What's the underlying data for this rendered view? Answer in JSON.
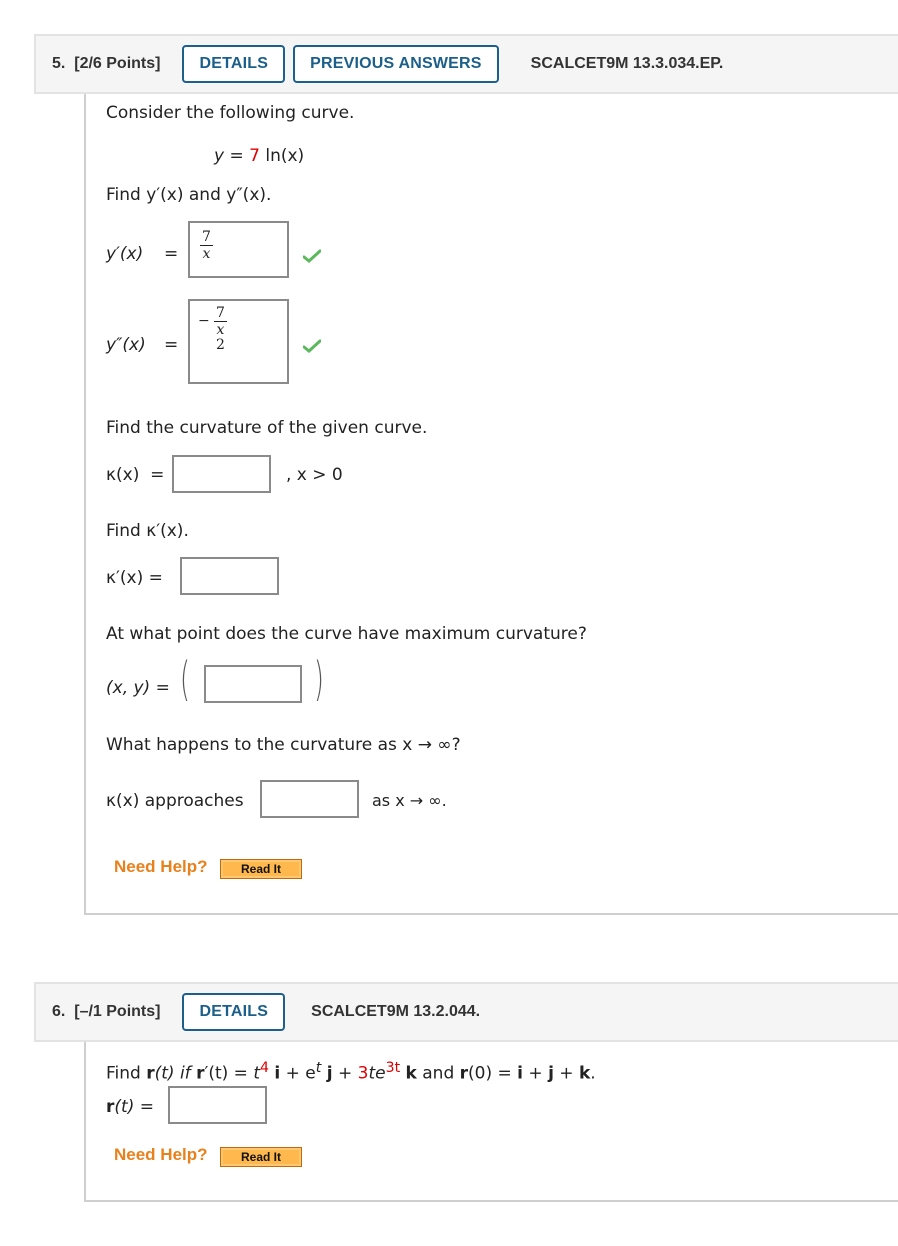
{
  "q5": {
    "number": "5.",
    "points": "[2/6 Points]",
    "details_label": "DETAILS",
    "previous_answers_label": "PREVIOUS ANSWERS",
    "code": "SCALCET9M 13.3.034.EP.",
    "intro": "Consider the following curve.",
    "equation": {
      "lhs": "y",
      "eq": "=",
      "coef": "7",
      "rhs": "ln(x)"
    },
    "find_derivs": "Find y′(x) and y″(x).",
    "yprime_label": "y′(x)",
    "yprime_answer": {
      "num": "7",
      "den": "x",
      "status": "correct"
    },
    "ydouble_label": "y″(x)",
    "ydouble_answer": {
      "sign": "−",
      "num": "7",
      "den": "x",
      "extra": "2",
      "status": "correct"
    },
    "equals": "=",
    "curvature_prompt": "Find the curvature of the given curve.",
    "kappa_label": "κ(x)",
    "kappa_condition": ", x > 0",
    "kappa_value": "",
    "kprime_prompt": "Find κ′(x).",
    "kprime_label": "κ′(x)",
    "kprime_value": "",
    "max_prompt": "At what point does the curve have maximum curvature?",
    "point_label": "(x, y)",
    "point_value": "",
    "limit_prompt": "What happens to the curvature as x → ∞?",
    "approaches_label": "κ(x) approaches",
    "approaches_value": "",
    "approaches_suffix": "as x → ∞.",
    "need_help": "Need Help?",
    "read_it": "Read It"
  },
  "q6": {
    "number": "6.",
    "points": "[–/1 Points]",
    "details_label": "DETAILS",
    "code": "SCALCET9M 13.2.044.",
    "prompt": {
      "find": "Find ",
      "r": "r",
      "t_arg": "(t) if ",
      "rprime": "r",
      "rprime_arg": "′(t) = ",
      "t1": "t",
      "exp1": "4",
      "i": "i",
      "plus1": " + e",
      "exp2": "t",
      "j": "j",
      "plus2": " + ",
      "coef3": "3",
      "te": "te",
      "exp3": "3t",
      "k": "k",
      "and": " and ",
      "r0": "r",
      "r0_arg": "(0) = ",
      "i2": "i",
      "plus3": " + ",
      "j2": "j",
      "plus4": " + ",
      "k2": "k",
      "end": "."
    },
    "rt_label": "r",
    "rt_arg": "(t)",
    "equals": "=",
    "rt_value": "",
    "need_help": "Need Help?",
    "read_it": "Read It"
  }
}
